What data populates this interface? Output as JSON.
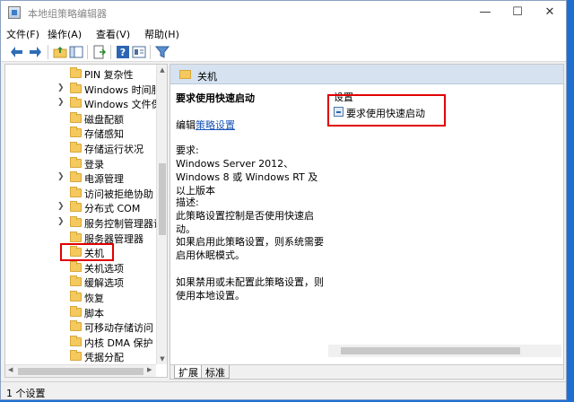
{
  "window": {
    "title": "本地组策略编辑器"
  },
  "menu": [
    "文件(F)",
    "操作(A)",
    "查看(V)",
    "帮助(H)"
  ],
  "toolbar": [
    "back-icon",
    "forward-icon",
    "folder-up-icon",
    "show-hide-tree-icon",
    "export-list-icon",
    "help-icon",
    "properties-icon",
    "filter-icon"
  ],
  "tree": [
    {
      "label": "PIN 复杂性",
      "expandable": false
    },
    {
      "label": "Windows 时间服",
      "expandable": true
    },
    {
      "label": "Windows 文件保",
      "expandable": true
    },
    {
      "label": "磁盘配额",
      "expandable": false
    },
    {
      "label": "存储感知",
      "expandable": false
    },
    {
      "label": "存储运行状况",
      "expandable": false
    },
    {
      "label": "登录",
      "expandable": false
    },
    {
      "label": "电源管理",
      "expandable": true
    },
    {
      "label": "访问被拒绝协助",
      "expandable": false
    },
    {
      "label": "分布式 COM",
      "expandable": true
    },
    {
      "label": "服务控制管理器设",
      "expandable": true
    },
    {
      "label": "服务器管理器",
      "expandable": false
    },
    {
      "label": "关机",
      "expandable": false,
      "selected": true
    },
    {
      "label": "关机选项",
      "expandable": false
    },
    {
      "label": "缓解选项",
      "expandable": false
    },
    {
      "label": "恢复",
      "expandable": false
    },
    {
      "label": "脚本",
      "expandable": false
    },
    {
      "label": "可移动存储访问",
      "expandable": false
    },
    {
      "label": "内核 DMA 保护",
      "expandable": false
    },
    {
      "label": "凭据分配",
      "expandable": false
    }
  ],
  "right": {
    "header": "关机",
    "policy_title": "要求使用快速启动",
    "edit_prefix": "编辑",
    "edit_link": "策略设置",
    "requirements_label": "要求:",
    "requirements": "Windows Server 2012、Windows 8 或 Windows RT 及以上版本",
    "description_label": "描述:",
    "description": "此策略设置控制是否使用快速启动。",
    "enabled_text": "如果启用此策略设置，则系统需要启用休眠模式。",
    "disabled_text": "如果禁用或未配置此策略设置，则使用本地设置。",
    "settings_header": "设置",
    "settings": [
      "要求使用快速启动"
    ],
    "tabs": [
      "扩展",
      "标准"
    ]
  },
  "status": "1 个设置",
  "colors": {
    "highlight": "#e00000",
    "header_bg": "#d6e2ef",
    "link": "#1a55b8",
    "desktop": "#1f6fd1"
  }
}
